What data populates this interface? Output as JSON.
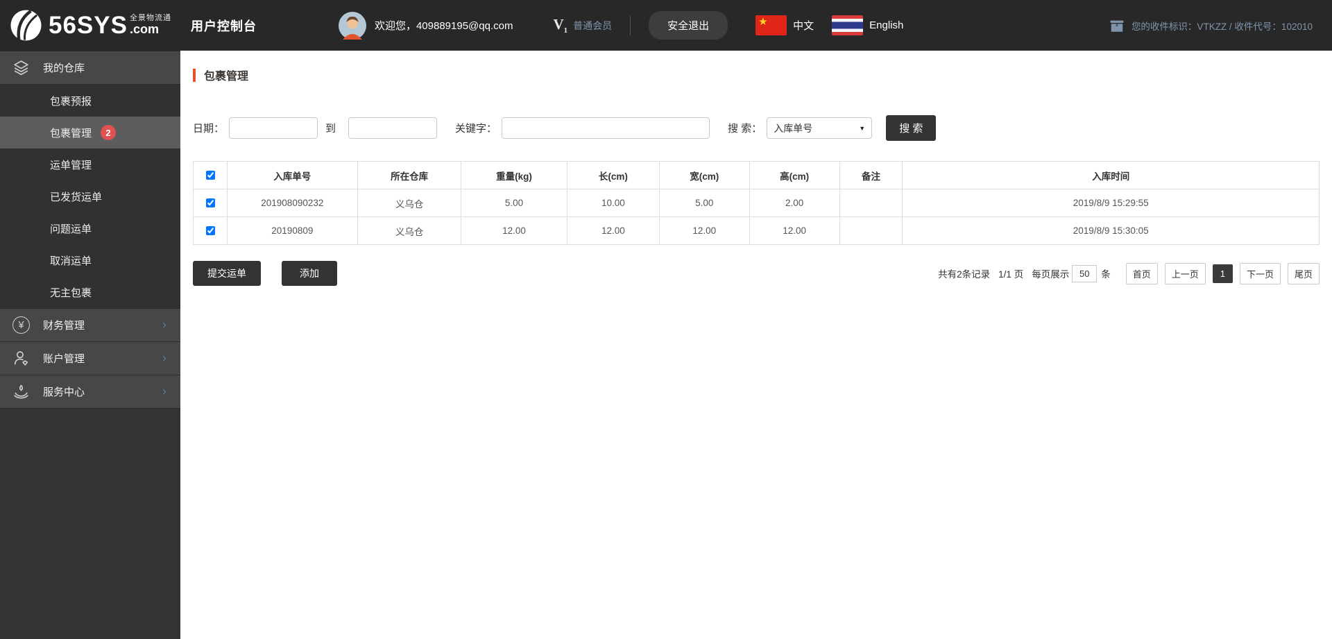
{
  "header": {
    "logo": {
      "name": "56SYS",
      "tld": ".com",
      "tagline": "全景物流通"
    },
    "console_title": "用户控制台",
    "welcome": "欢迎您，409889195@qq.com",
    "member_v": "V",
    "member_sub": "1",
    "member_level": "普通会员",
    "logout_label": "安全退出",
    "lang_chinese": "中文",
    "lang_english": "English",
    "receiver_info": "您的收件标识：VTKZZ / 收件代号：102010"
  },
  "sidebar": {
    "sections": [
      {
        "label": "我的仓库",
        "icon": "layers-icon"
      },
      {
        "label": "财务管理",
        "icon": "yen-icon"
      },
      {
        "label": "账户管理",
        "icon": "user-icon"
      },
      {
        "label": "服务中心",
        "icon": "service-icon"
      }
    ],
    "warehouse_items": [
      {
        "label": "包裹预报"
      },
      {
        "label": "包裹管理",
        "badge": "2",
        "active": true
      },
      {
        "label": "运单管理"
      },
      {
        "label": "已发货运单"
      },
      {
        "label": "问题运单"
      },
      {
        "label": "取消运单"
      },
      {
        "label": "无主包裹"
      }
    ]
  },
  "main": {
    "page_title": "包裹管理",
    "filters": {
      "date_label": "日期：",
      "to_label": "到",
      "keyword_label": "关键字：",
      "search_label": "搜 索：",
      "search_type_selected": "入库单号",
      "search_button": "搜 索"
    },
    "table": {
      "select_all_checked": true,
      "headers": [
        "入库单号",
        "所在仓库",
        "重量(kg)",
        "长(cm)",
        "宽(cm)",
        "高(cm)",
        "备注",
        "入库时间"
      ],
      "rows": [
        {
          "checked": true,
          "cells": [
            "201908090232",
            "义乌仓",
            "5.00",
            "10.00",
            "5.00",
            "2.00",
            "",
            "2019/8/9 15:29:55"
          ]
        },
        {
          "checked": true,
          "cells": [
            "20190809",
            "义乌仓",
            "12.00",
            "12.00",
            "12.00",
            "12.00",
            "",
            "2019/8/9 15:30:05"
          ]
        }
      ]
    },
    "actions": {
      "submit_waybill": "提交运单",
      "add": "添加"
    },
    "pagination": {
      "total_text": "共有2条记录",
      "page_text": "1/1 页",
      "per_page_label": "每页展示",
      "per_page_value": "50",
      "unit_label": "条",
      "first": "首页",
      "prev": "上一页",
      "current": "1",
      "next": "下一页",
      "last": "尾页"
    }
  },
  "colors": {
    "accent": "#e8502b",
    "badge": "#e25151",
    "header_link": "#8095ab",
    "topbar_bg": "#282828",
    "sidebar_bg": "#333333"
  }
}
